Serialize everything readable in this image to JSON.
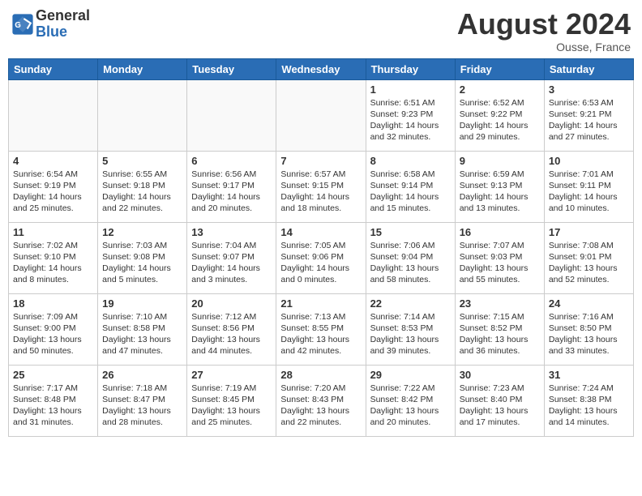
{
  "header": {
    "logo_line1": "General",
    "logo_line2": "Blue",
    "month_year": "August 2024",
    "location": "Ousse, France"
  },
  "weekdays": [
    "Sunday",
    "Monday",
    "Tuesday",
    "Wednesday",
    "Thursday",
    "Friday",
    "Saturday"
  ],
  "weeks": [
    [
      {
        "date": "",
        "info": ""
      },
      {
        "date": "",
        "info": ""
      },
      {
        "date": "",
        "info": ""
      },
      {
        "date": "",
        "info": ""
      },
      {
        "date": "1",
        "info": "Sunrise: 6:51 AM\nSunset: 9:23 PM\nDaylight: 14 hours\nand 32 minutes."
      },
      {
        "date": "2",
        "info": "Sunrise: 6:52 AM\nSunset: 9:22 PM\nDaylight: 14 hours\nand 29 minutes."
      },
      {
        "date": "3",
        "info": "Sunrise: 6:53 AM\nSunset: 9:21 PM\nDaylight: 14 hours\nand 27 minutes."
      }
    ],
    [
      {
        "date": "4",
        "info": "Sunrise: 6:54 AM\nSunset: 9:19 PM\nDaylight: 14 hours\nand 25 minutes."
      },
      {
        "date": "5",
        "info": "Sunrise: 6:55 AM\nSunset: 9:18 PM\nDaylight: 14 hours\nand 22 minutes."
      },
      {
        "date": "6",
        "info": "Sunrise: 6:56 AM\nSunset: 9:17 PM\nDaylight: 14 hours\nand 20 minutes."
      },
      {
        "date": "7",
        "info": "Sunrise: 6:57 AM\nSunset: 9:15 PM\nDaylight: 14 hours\nand 18 minutes."
      },
      {
        "date": "8",
        "info": "Sunrise: 6:58 AM\nSunset: 9:14 PM\nDaylight: 14 hours\nand 15 minutes."
      },
      {
        "date": "9",
        "info": "Sunrise: 6:59 AM\nSunset: 9:13 PM\nDaylight: 14 hours\nand 13 minutes."
      },
      {
        "date": "10",
        "info": "Sunrise: 7:01 AM\nSunset: 9:11 PM\nDaylight: 14 hours\nand 10 minutes."
      }
    ],
    [
      {
        "date": "11",
        "info": "Sunrise: 7:02 AM\nSunset: 9:10 PM\nDaylight: 14 hours\nand 8 minutes."
      },
      {
        "date": "12",
        "info": "Sunrise: 7:03 AM\nSunset: 9:08 PM\nDaylight: 14 hours\nand 5 minutes."
      },
      {
        "date": "13",
        "info": "Sunrise: 7:04 AM\nSunset: 9:07 PM\nDaylight: 14 hours\nand 3 minutes."
      },
      {
        "date": "14",
        "info": "Sunrise: 7:05 AM\nSunset: 9:06 PM\nDaylight: 14 hours\nand 0 minutes."
      },
      {
        "date": "15",
        "info": "Sunrise: 7:06 AM\nSunset: 9:04 PM\nDaylight: 13 hours\nand 58 minutes."
      },
      {
        "date": "16",
        "info": "Sunrise: 7:07 AM\nSunset: 9:03 PM\nDaylight: 13 hours\nand 55 minutes."
      },
      {
        "date": "17",
        "info": "Sunrise: 7:08 AM\nSunset: 9:01 PM\nDaylight: 13 hours\nand 52 minutes."
      }
    ],
    [
      {
        "date": "18",
        "info": "Sunrise: 7:09 AM\nSunset: 9:00 PM\nDaylight: 13 hours\nand 50 minutes."
      },
      {
        "date": "19",
        "info": "Sunrise: 7:10 AM\nSunset: 8:58 PM\nDaylight: 13 hours\nand 47 minutes."
      },
      {
        "date": "20",
        "info": "Sunrise: 7:12 AM\nSunset: 8:56 PM\nDaylight: 13 hours\nand 44 minutes."
      },
      {
        "date": "21",
        "info": "Sunrise: 7:13 AM\nSunset: 8:55 PM\nDaylight: 13 hours\nand 42 minutes."
      },
      {
        "date": "22",
        "info": "Sunrise: 7:14 AM\nSunset: 8:53 PM\nDaylight: 13 hours\nand 39 minutes."
      },
      {
        "date": "23",
        "info": "Sunrise: 7:15 AM\nSunset: 8:52 PM\nDaylight: 13 hours\nand 36 minutes."
      },
      {
        "date": "24",
        "info": "Sunrise: 7:16 AM\nSunset: 8:50 PM\nDaylight: 13 hours\nand 33 minutes."
      }
    ],
    [
      {
        "date": "25",
        "info": "Sunrise: 7:17 AM\nSunset: 8:48 PM\nDaylight: 13 hours\nand 31 minutes."
      },
      {
        "date": "26",
        "info": "Sunrise: 7:18 AM\nSunset: 8:47 PM\nDaylight: 13 hours\nand 28 minutes."
      },
      {
        "date": "27",
        "info": "Sunrise: 7:19 AM\nSunset: 8:45 PM\nDaylight: 13 hours\nand 25 minutes."
      },
      {
        "date": "28",
        "info": "Sunrise: 7:20 AM\nSunset: 8:43 PM\nDaylight: 13 hours\nand 22 minutes."
      },
      {
        "date": "29",
        "info": "Sunrise: 7:22 AM\nSunset: 8:42 PM\nDaylight: 13 hours\nand 20 minutes."
      },
      {
        "date": "30",
        "info": "Sunrise: 7:23 AM\nSunset: 8:40 PM\nDaylight: 13 hours\nand 17 minutes."
      },
      {
        "date": "31",
        "info": "Sunrise: 7:24 AM\nSunset: 8:38 PM\nDaylight: 13 hours\nand 14 minutes."
      }
    ]
  ]
}
